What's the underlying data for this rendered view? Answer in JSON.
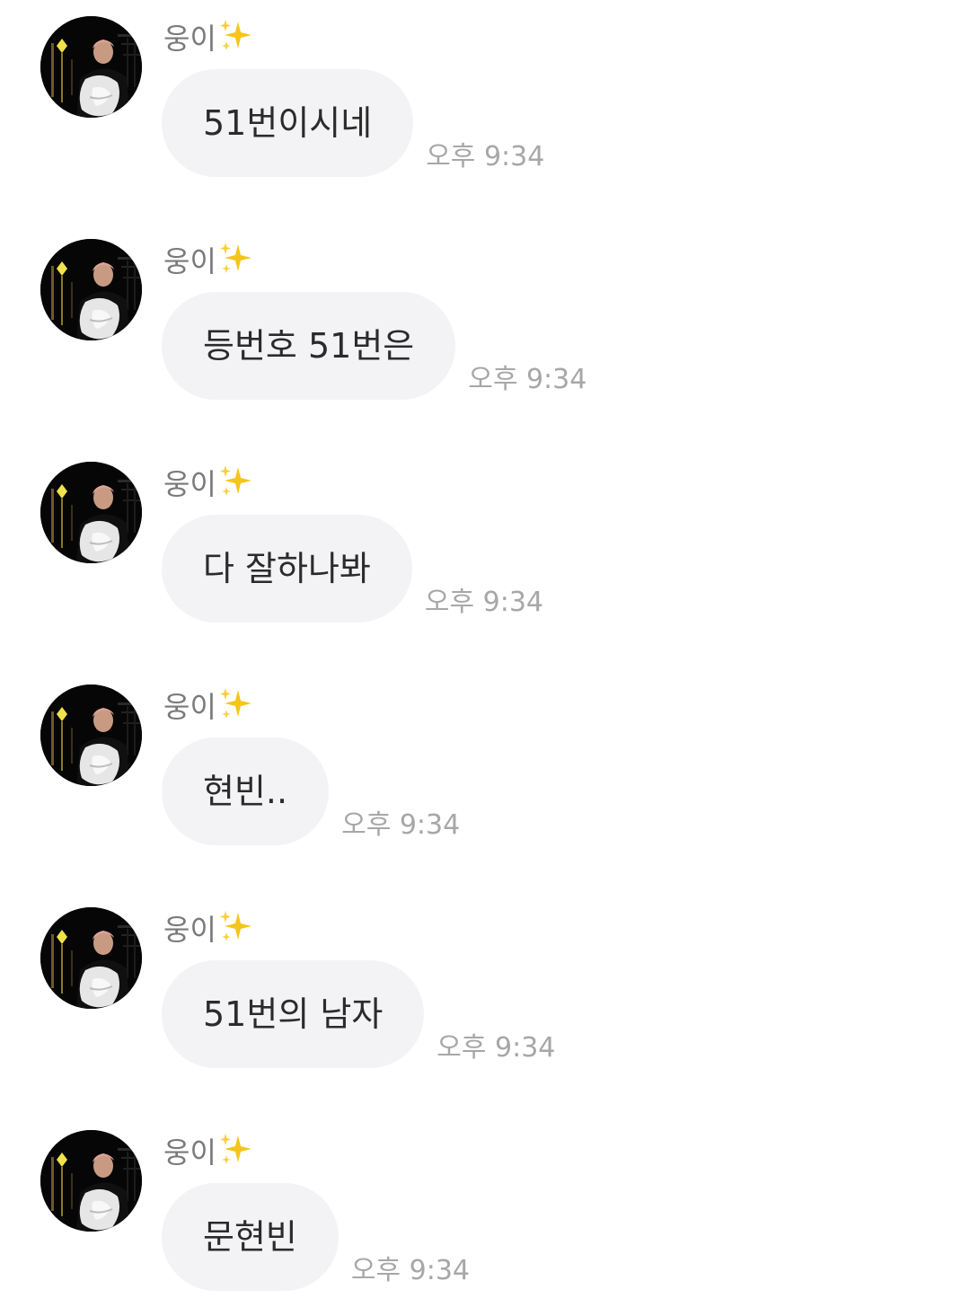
{
  "messages": [
    {
      "sender": "웅이",
      "text": "51번이시네",
      "time": "오후 9:34"
    },
    {
      "sender": "웅이",
      "text": "등번호 51번은",
      "time": "오후 9:34"
    },
    {
      "sender": "웅이",
      "text": "다 잘하나봐",
      "time": "오후 9:34"
    },
    {
      "sender": "웅이",
      "text": "현빈..",
      "time": "오후 9:34"
    },
    {
      "sender": "웅이",
      "text": "51번의 남자",
      "time": "오후 9:34"
    },
    {
      "sender": "웅이",
      "text": "문현빈",
      "time": "오후 9:34"
    }
  ],
  "icons": {
    "sender_suffix": "sparkles-icon",
    "avatar": "profile-photo-avatar"
  },
  "colors": {
    "bubble_bg": "#f3f3f5",
    "bubble_text": "#2b2b2b",
    "sender_name": "#7a7a7a",
    "timestamp": "#a7a7a7",
    "sparkle": "#f5c518"
  }
}
